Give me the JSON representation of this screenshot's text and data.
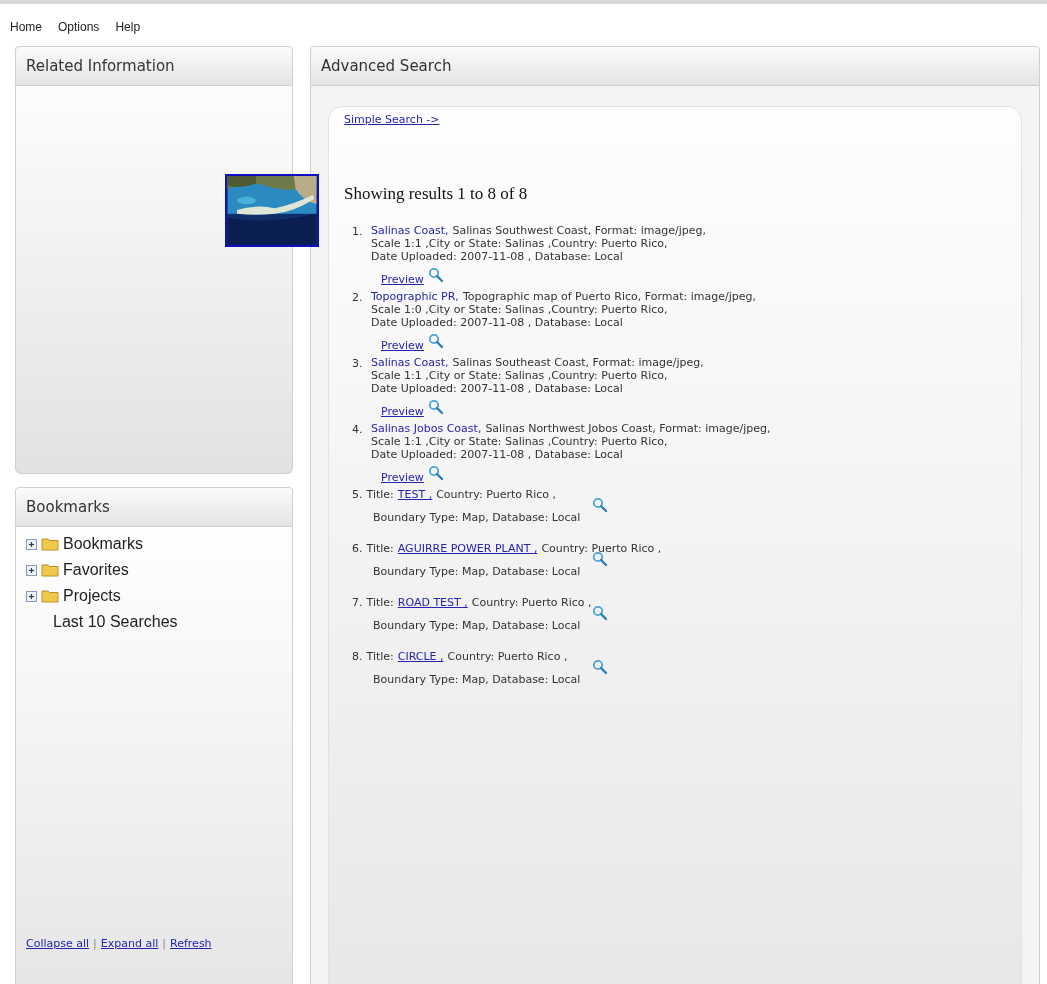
{
  "menu": [
    "Home",
    "Options",
    "Help"
  ],
  "related_panel": {
    "title": "Related Information"
  },
  "bookmarks_panel": {
    "title": "Bookmarks",
    "tree": [
      {
        "label": "Bookmarks",
        "kind": "folder",
        "expanded": false
      },
      {
        "label": "Favorites",
        "kind": "folder",
        "expanded": false
      },
      {
        "label": "Projects",
        "kind": "folder",
        "expanded": false
      },
      {
        "label": "Last 10 Searches",
        "kind": "leaf"
      }
    ],
    "footer_links": [
      "Collapse all",
      "Expand all",
      "Refresh"
    ],
    "footer_separators": [
      "|",
      "|"
    ]
  },
  "search_panel": {
    "title": "Advanced Search",
    "simple_search_link": "Simple Search ->",
    "summary": "Showing results 1 to 8 of 8",
    "results": [
      {
        "kind": "record",
        "number": "1.",
        "title": "Salinas Coast,",
        "lines": [
          "Salinas Southwest Coast, Format: image/jpeg,",
          "Scale 1:1 ,City or State: Salinas ,Country: Puerto Rico,",
          "Date Uploaded: 2007-11-08 , Database: Local"
        ],
        "preview": "Preview"
      },
      {
        "kind": "record",
        "number": "2.",
        "title": "Topographic PR,",
        "lines": [
          "Topographic map of Puerto Rico, Format: image/jpeg,",
          "Scale 1:0 ,City or State: Salinas ,Country: Puerto Rico,",
          "Date Uploaded: 2007-11-08 , Database: Local"
        ],
        "preview": "Preview"
      },
      {
        "kind": "record",
        "number": "3.",
        "title": "Salinas Coast,",
        "lines": [
          "Salinas Southeast Coast, Format: image/jpeg,",
          "Scale 1:1 ,City or State: Salinas ,Country: Puerto Rico,",
          "Date Uploaded: 2007-11-08 , Database: Local"
        ],
        "preview": "Preview"
      },
      {
        "kind": "record",
        "number": "4.",
        "title": "Salinas Jobos Coast,",
        "lines": [
          "Salinas Northwest Jobos Coast, Format: image/jpeg,",
          "Scale 1:1 ,City or State: Salinas ,Country: Puerto Rico,",
          "Date Uploaded: 2007-11-08 , Database: Local"
        ],
        "preview": "Preview"
      },
      {
        "kind": "boundary",
        "number": "5.",
        "label": "Title:",
        "title": "TEST ,",
        "country": "Country: Puerto Rico ,",
        "detail": "Boundary Type: Map, Database: Local"
      },
      {
        "kind": "boundary",
        "number": "6.",
        "label": "Title:",
        "title": "AGUIRRE POWER PLANT ,",
        "country": "Country: Puerto Rico ,",
        "detail": "Boundary Type: Map, Database: Local"
      },
      {
        "kind": "boundary",
        "number": "7.",
        "label": "Title:",
        "title": "ROAD TEST ,",
        "country": "Country: Puerto Rico ,",
        "detail": "Boundary Type: Map, Database: Local"
      },
      {
        "kind": "boundary",
        "number": "8.",
        "label": "Title:",
        "title": "CIRCLE ,",
        "country": "Country: Puerto Rico ,",
        "detail": "Boundary Type: Map, Database: Local"
      }
    ]
  }
}
